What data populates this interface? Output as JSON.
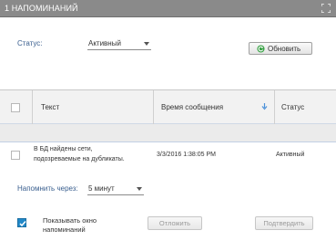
{
  "window": {
    "title": "1 НАПОМИНАНИЙ",
    "maximize_icon": "maximize-icon"
  },
  "filter": {
    "status_label": "Статус:",
    "status_value": "Активный",
    "refresh_label": "Обновить",
    "refresh_icon": "refresh-icon"
  },
  "table": {
    "columns": {
      "text": "Текст",
      "time": "Время сообщения",
      "status": "Статус"
    },
    "sort_icon": "sort-down-arrow-icon",
    "rows": [
      {
        "text_line1": "В БД найдены сети,",
        "text_line2": "подозреваемые на дубликаты.",
        "time": "3/3/2016 1:38:05 PM",
        "status": "Активный"
      }
    ]
  },
  "remind": {
    "label": "Напомнить через:",
    "value": "5 минут"
  },
  "footer": {
    "show_window_label": "Показывать окно напоминаний",
    "show_window_checked": true,
    "postpone_label": "Отложить",
    "confirm_label": "Подтвердить"
  },
  "colors": {
    "titlebar": "#8a8a8a",
    "label_blue": "#3a5f8f",
    "checkbox_blue": "#2288c8"
  }
}
